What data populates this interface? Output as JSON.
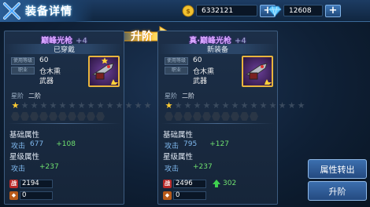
{
  "header": {
    "title": "装备详情",
    "gold": "6332121",
    "diamonds": "12608",
    "plus_label": "+"
  },
  "upgrade_label": "升阶",
  "current": {
    "name": "巅峰光枪",
    "level": "+4",
    "state": "已穿戴",
    "use_level_label": "使用等级",
    "use_level": "60",
    "job_label": "职业",
    "job": "仓木熏",
    "type": "武器",
    "rank_label": "星阶",
    "rank": "二阶",
    "stars_total": 15,
    "stars_lit": 1,
    "base_title": "基础属性",
    "attack_label": "攻击",
    "base_attack": "677",
    "base_bonus": "+108",
    "star_title": "星级属性",
    "star_bonus": "+237",
    "power": "2194",
    "other": "0"
  },
  "next": {
    "name": "真·巅峰光枪",
    "level": "+4",
    "state": "新装备",
    "use_level_label": "使用等级",
    "use_level": "60",
    "job_label": "职业",
    "job": "仓木熏",
    "type": "武器",
    "rank_label": "星阶",
    "rank": "二阶",
    "stars_total": 15,
    "stars_lit": 1,
    "base_title": "基础属性",
    "attack_label": "攻击",
    "base_attack": "795",
    "base_bonus": "+127",
    "star_title": "星级属性",
    "star_bonus": "+237",
    "power": "2496",
    "power_gain": "302",
    "other": "0"
  },
  "buttons": {
    "transfer": "属性转出",
    "upgrade": "升阶"
  },
  "colors": {
    "gold": "#ffcc33",
    "accent": "#3c6fae",
    "bonus": "#6fe06f",
    "attack": "#7fb8ee"
  }
}
